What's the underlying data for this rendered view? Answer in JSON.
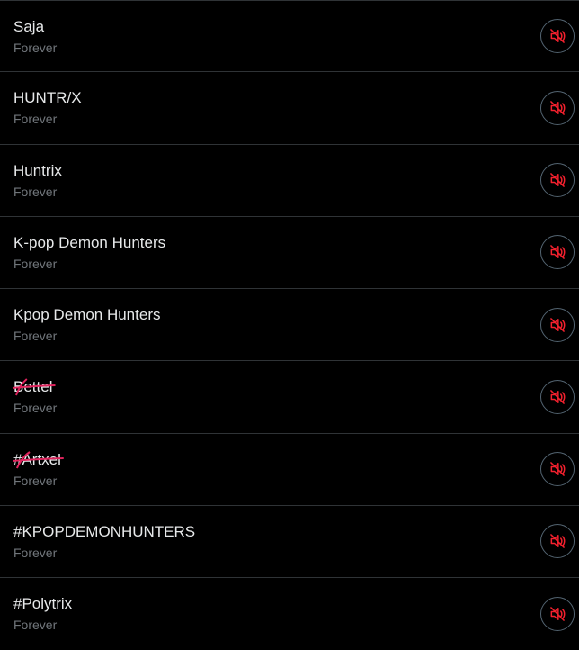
{
  "muted_words": [
    {
      "term": "Saja",
      "duration": "Forever",
      "struck": false
    },
    {
      "term": "HUNTR/X",
      "duration": "Forever",
      "struck": false
    },
    {
      "term": "Huntrix",
      "duration": "Forever",
      "struck": false
    },
    {
      "term": "K-pop Demon Hunters",
      "duration": "Forever",
      "struck": false
    },
    {
      "term": "Kpop Demon Hunters",
      "duration": "Forever",
      "struck": false
    },
    {
      "term": "Bettel",
      "duration": "Forever",
      "struck": true
    },
    {
      "term": "#Artxel",
      "duration": "Forever",
      "struck": true
    },
    {
      "term": "#KPOPDEMONHUNTERS",
      "duration": "Forever",
      "struck": false
    },
    {
      "term": "#Polytrix",
      "duration": "Forever",
      "struck": false
    }
  ],
  "unmute_icon": "muted-speaker-icon",
  "colors": {
    "background": "#000000",
    "divider": "#2f3336",
    "primary_text": "#e7e9ea",
    "secondary_text": "#71767b",
    "icon_red": "#f4212e",
    "button_border": "#536471",
    "scribble_red": "#e0245e"
  }
}
